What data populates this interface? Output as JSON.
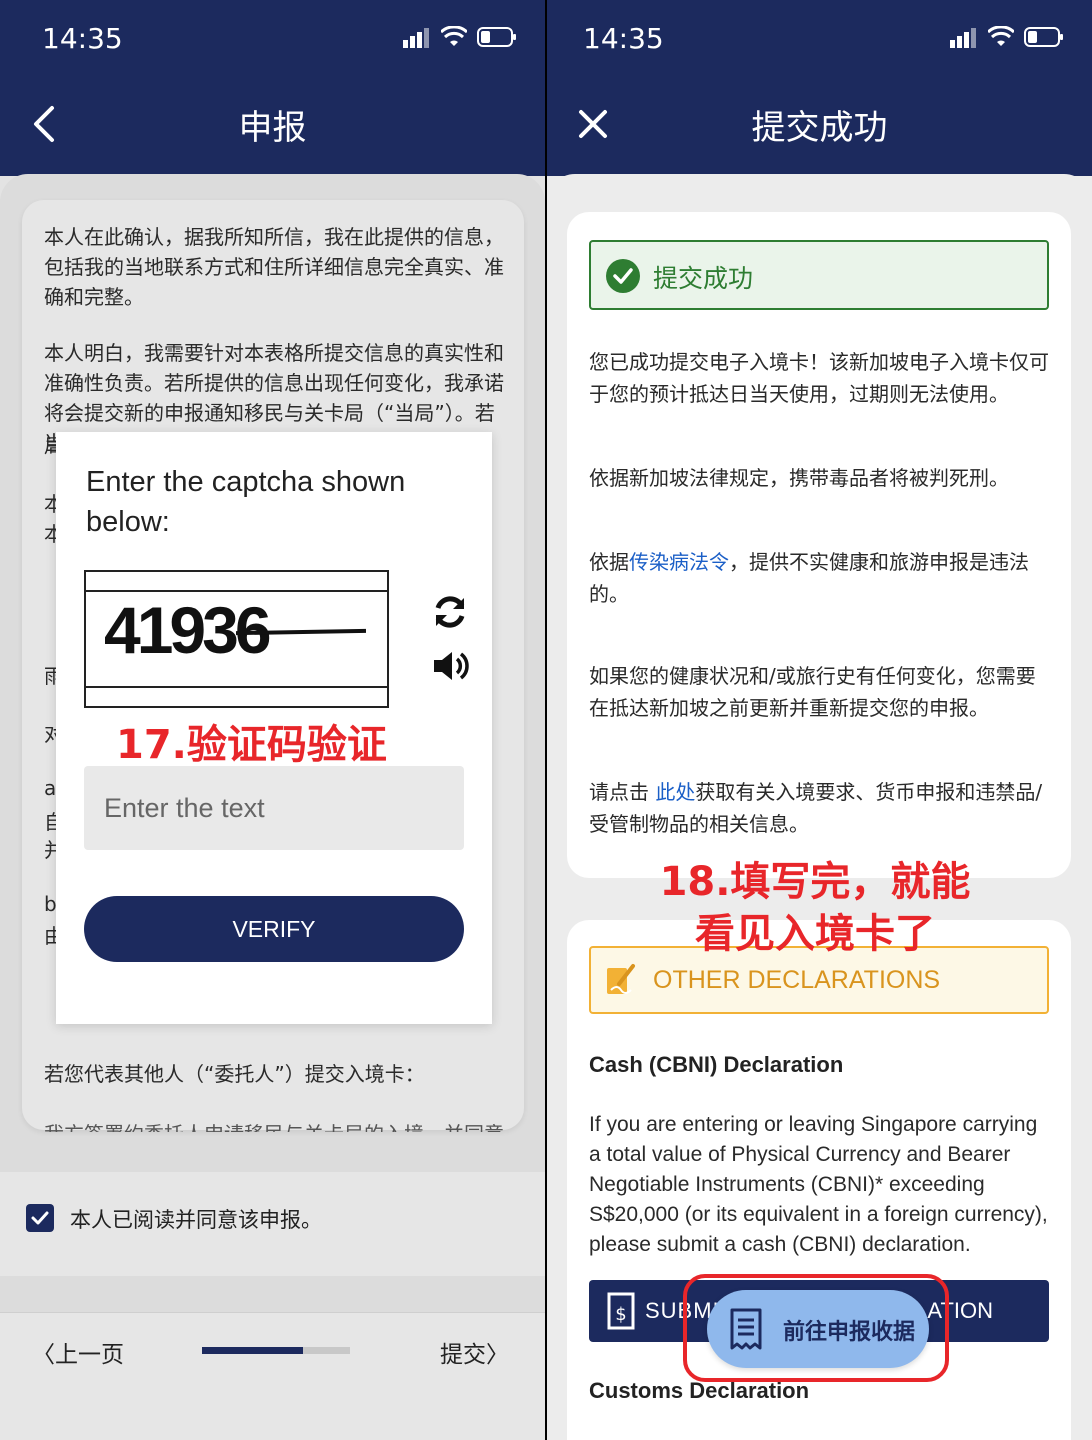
{
  "left": {
    "status": {
      "time": "14:35"
    },
    "header": {
      "title": "申报"
    },
    "paragraphs": {
      "p1": "本人在此确认，据我所知所信，我在此提供的信息，包括我的当地联系方式和住所详细信息完全真实、准确和完整。",
      "p2": "本人明白，我需要针对本表格所提交信息的真实性和准确性负责。若所提供的信息出现任何变化，我承诺将会提交新的申报通知移民与关卡局（“当局”）。若当",
      "fragments": [
        "局",
        "本",
        "本",
        "雨",
        "对",
        "a",
        "自",
        "并",
        "b",
        "由"
      ]
    },
    "captcha_modal": {
      "title": "Enter the captcha shown below:",
      "code": "41936",
      "input_placeholder": "Enter the text",
      "verify_label": "VERIFY",
      "annotation": "17.验证码验证"
    },
    "delegate_text": "若您代表其他人（“委托人”）提交入境卡：",
    "delegate_cut": "我方签署约委托人申请移民与关卡局的入境，并同意一切约定",
    "consent": {
      "label": "本人已阅读并同意该申报。",
      "checked": true
    },
    "footer": {
      "prev": "上一页",
      "submit": "提交",
      "progress": 0.68
    }
  },
  "right": {
    "status": {
      "time": "14:35"
    },
    "header": {
      "title": "提交成功"
    },
    "success_banner": "提交成功",
    "paragraphs": {
      "p1": "您已成功提交电子入境卡！该新加坡电子入境卡仅可于您的预计抵达日当天使用，过期则无法使用。",
      "p2": "依据新加坡法律规定，携带毒品者将被判死刑。",
      "p3_pre": "依据",
      "p3_link": "传染病法令",
      "p3_post": "，提供不实健康和旅游申报是违法的。",
      "p4": "如果您的健康状况和/或旅行史有任何变化，您需要在抵达新加坡之前更新并重新提交您的申报。",
      "p5_pre": "请点击 ",
      "p5_link": "此处",
      "p5_post": "获取有关入境要求、货币申报和违禁品/受管制物品的相关信息。"
    },
    "other_declarations": "OTHER DECLARATIONS",
    "cash": {
      "title": "Cash (CBNI) Declaration",
      "body": "If you are entering or leaving Singapore carrying a total value of Physical Currency and Bearer Negotiable Instruments (CBNI)* exceeding S$20,000 (or its equivalent in a foreign currency), please submit a cash (CBNI) declaration.",
      "button_left": "SUBMI",
      "button_right": "ATION"
    },
    "customs_title": "Customs Declaration",
    "fab_label": "前往申报收据",
    "annotation_line1": "18.填写完，就能",
    "annotation_line2": "看见入境卡了"
  },
  "colors": {
    "navy": "#1c2a5e",
    "success": "#2e7d32",
    "warning": "#f2b135",
    "annotation": "#e8262a",
    "link": "#1b5fc7"
  },
  "icons": [
    "signal-icon",
    "wifi-icon",
    "battery-icon",
    "back-arrow-icon",
    "close-icon",
    "refresh-icon",
    "speaker-icon",
    "check-icon",
    "checkmark-circle-icon",
    "signature-icon",
    "cash-receipt-icon",
    "receipt-icon"
  ]
}
